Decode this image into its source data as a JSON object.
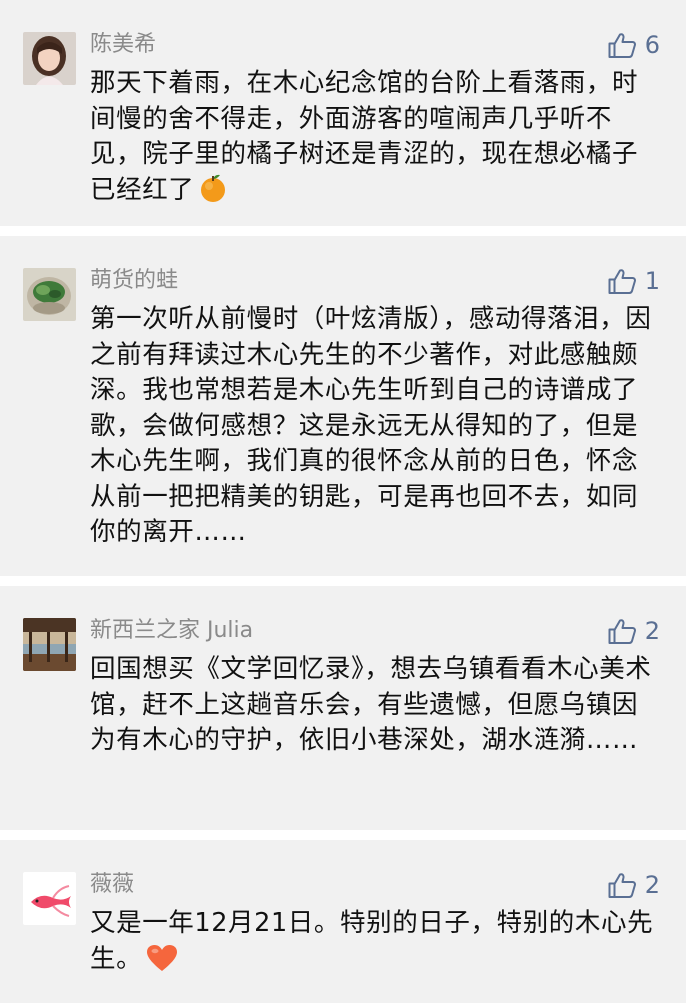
{
  "comments": [
    {
      "name": "陈美希",
      "likes": "6",
      "text": "那天下着雨，在木心纪念馆的台阶上看落雨，时间慢的舍不得走，外面游客的喧闹声几乎听不见，院子里的橘子树还是青涩的，现在想必橘子已经红了",
      "emoji": "orange-emoji",
      "avatar": "avatar-girl-photo"
    },
    {
      "name": "萌货的蛙",
      "likes": "1",
      "text": "第一次听从前慢时（叶炫清版），感动得落泪，因之前有拜读过木心先生的不少著作，对此感触颇深。我也常想若是木心先生听到自己的诗谱成了歌，会做何感想？这是永远无从得知的了，但是木心先生啊，我们真的很怀念从前的日色，怀念从前一把把精美的钥匙，可是再也回不去，如同你的离开……",
      "emoji": "",
      "avatar": "avatar-plant-photo"
    },
    {
      "name": "新西兰之家 Julia",
      "likes": "2",
      "text": "回国想买《文学回忆录》，想去乌镇看看木心美术馆，赶不上这趟音乐会，有些遗憾，但愿乌镇因为有木心的守护，依旧小巷深处，湖水涟漪……",
      "emoji": "",
      "avatar": "avatar-porch-photo"
    },
    {
      "name": "薇薇",
      "likes": "2",
      "text": "又是一年12月21日。特别的日子，特别的木心先生。",
      "emoji": "heart-emoji",
      "avatar": "avatar-fish-drawing"
    }
  ],
  "colors": {
    "card_background": "#f1f1f1",
    "name": "#8a8a8a",
    "like_icon": "#5a6f93",
    "text": "#111111"
  }
}
